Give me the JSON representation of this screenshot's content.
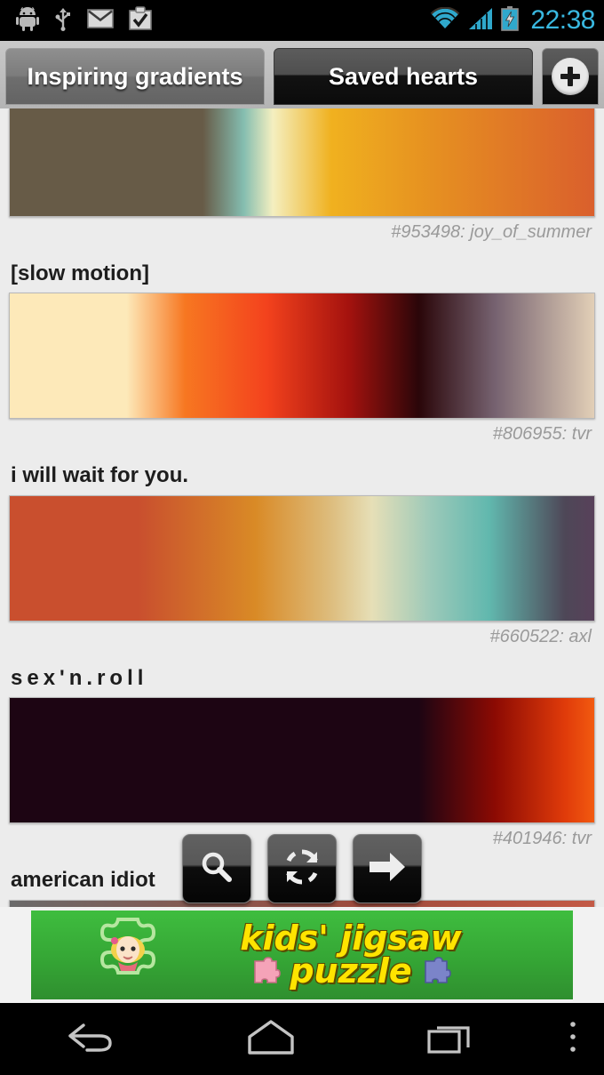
{
  "statusbar": {
    "clock": "22:38",
    "left_icons": [
      {
        "name": "android-debug-icon"
      },
      {
        "name": "usb-icon"
      },
      {
        "name": "gmail-icon"
      },
      {
        "name": "task-checkmark-icon"
      }
    ],
    "right_icons": [
      {
        "name": "wifi-icon"
      },
      {
        "name": "cellular-signal-icon"
      },
      {
        "name": "battery-charging-icon"
      }
    ]
  },
  "tabs": [
    {
      "label": "Inspiring gradients",
      "selected": true
    },
    {
      "label": "Saved hearts",
      "selected": false
    }
  ],
  "add_button": {
    "label": "+",
    "icon": "plus-circle-icon"
  },
  "gradients": [
    {
      "title": "",
      "credit": "#953498: joy_of_summer",
      "css": "linear-gradient(to right, #675b47 0%, #675b47 33%, #84bdb0 40%, #f4efc0 45%, #f0b11f 55%, #e79420 70%, #da5f2c 100%)",
      "stops": [
        "#675b47",
        "#84bdb0",
        "#f4efc0",
        "#f0b11f",
        "#e79420",
        "#da5f2c"
      ],
      "clipped_top": true
    },
    {
      "title": "[slow motion]",
      "credit": "#806955: tvr",
      "css": "linear-gradient(to right, #fde9b9 0%, #fde9b9 20%, #f77721 30%, #f3421d 44%, #a4120e 58%, #2a0609 70%, #766270 83%, #e2cfb7 100%)",
      "stops": [
        "#fde9b9",
        "#f77721",
        "#f3421d",
        "#a4120e",
        "#2a0609",
        "#766270",
        "#e2cfb7"
      ],
      "clipped_top": false
    },
    {
      "title": "i will wait for you.",
      "credit": "#660522: axl",
      "css": "linear-gradient(to right, #c94f2e 0%, #c94f2e 22%, #d98a26 42%, #ddbd7e 55%, #e6dfb7 62%, #9cc9b9 72%, #61b8ae 82%, #4e4757 95%, #58415a 100%)",
      "stops": [
        "#c94f2e",
        "#d98a26",
        "#ddbd7e",
        "#e6dfb7",
        "#61b8ae",
        "#4e4757"
      ],
      "clipped_top": false
    },
    {
      "title": "sex'n.roll",
      "credit": "#401946: tvr",
      "css": "linear-gradient(to right, #1d0513 0%, #1d0513 70%, #8c0a03 83%, #e03b0a 95%, #f25a10 100%)",
      "stops": [
        "#1d0513",
        "#8c0a03",
        "#e03b0a",
        "#f25a10"
      ],
      "clipped_top": false
    },
    {
      "title": "american idiot",
      "credit": "",
      "css": "linear-gradient(to right, #6a6a6a 0%, #9e4a3c 60%, #c35a46 100%)",
      "stops": [
        "#6a6a6a",
        "#c35a46"
      ],
      "clipped_top": false
    }
  ],
  "actions": [
    {
      "name": "search-button",
      "icon": "search-icon"
    },
    {
      "name": "refresh-button",
      "icon": "refresh-icon"
    },
    {
      "name": "next-button",
      "icon": "arrow-right-icon"
    }
  ],
  "ad": {
    "line1": "kids' jigsaw",
    "line2": "puzzle",
    "background_color": "#35a635",
    "text_color": "#ffe400"
  },
  "navbar": [
    {
      "name": "nav-back-button",
      "icon": "back-icon"
    },
    {
      "name": "nav-home-button",
      "icon": "home-icon"
    },
    {
      "name": "nav-recents-button",
      "icon": "recents-icon"
    },
    {
      "name": "nav-overflow-button",
      "icon": "overflow-menu-icon"
    }
  ]
}
